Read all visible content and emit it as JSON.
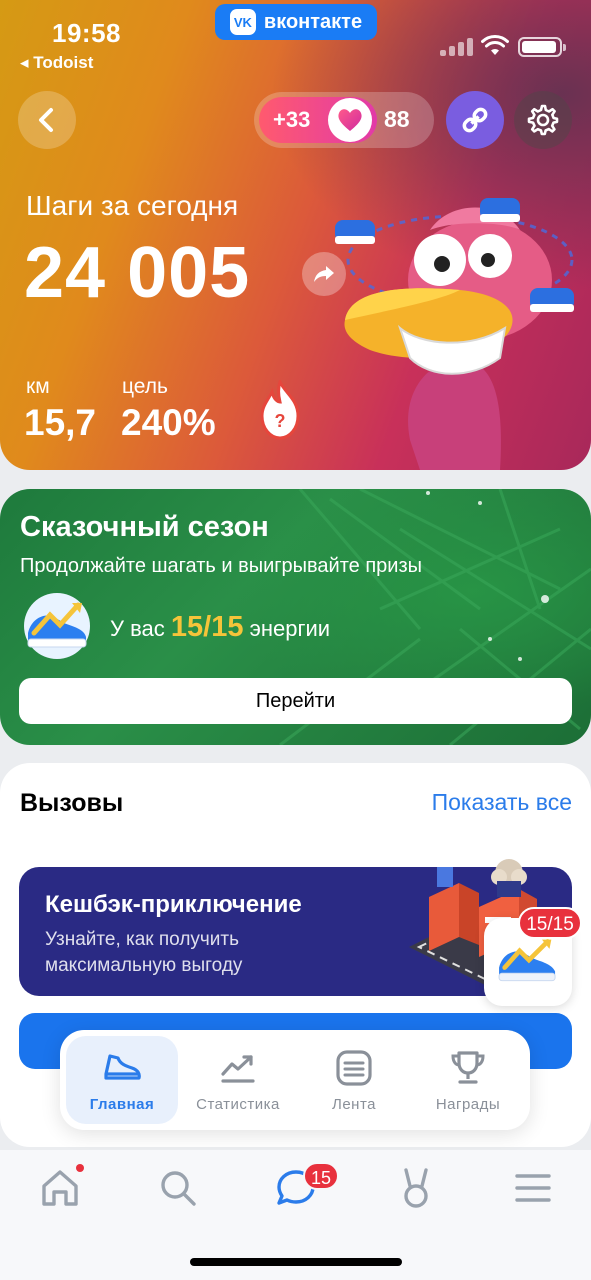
{
  "status_bar": {
    "time": "19:58",
    "back_app": "◂ Todoist",
    "vk_badge": "вконтакте",
    "vk_logo": "VK"
  },
  "header": {
    "hearts_bonus": "+33",
    "hearts_count": "88"
  },
  "steps": {
    "label": "Шаги за сегодня",
    "value": "24 005",
    "km_label": "км",
    "km_value": "15,7",
    "goal_label": "цель",
    "goal_value": "240%",
    "fire_icon_text": "?"
  },
  "season": {
    "title": "Сказочный сезон",
    "subtitle": "Продолжайте шагать и выигрывайте призы",
    "energy_prefix": "У вас",
    "energy_value": "15/15",
    "energy_suffix": "энергии",
    "go_button": "Перейти"
  },
  "challenges": {
    "title": "Вызовы",
    "show_all": "Показать все",
    "cashback_title": "Кешбэк-приключение",
    "cashback_line1": "Узнайте, как получить",
    "cashback_line2": "максимальную выгоду",
    "energy_badge": "15/15"
  },
  "inner_nav": {
    "items": [
      {
        "label": "Главная",
        "icon": "sneaker-icon",
        "active": true
      },
      {
        "label": "Статистика",
        "icon": "chart-trend-icon",
        "active": false
      },
      {
        "label": "Лента",
        "icon": "feed-icon",
        "active": false
      },
      {
        "label": "Награды",
        "icon": "trophy-icon",
        "active": false
      }
    ]
  },
  "tabbar": {
    "messages_badge": "15",
    "items": [
      "home-icon",
      "search-icon",
      "messages-icon",
      "services-icon",
      "menu-icon"
    ]
  },
  "colors": {
    "accent_blue": "#2b7cea",
    "energy_yellow": "#f5c43a",
    "badge_red": "#e8313d",
    "season_green": "#1e7a3c",
    "cashback_navy": "#2a2a84"
  }
}
